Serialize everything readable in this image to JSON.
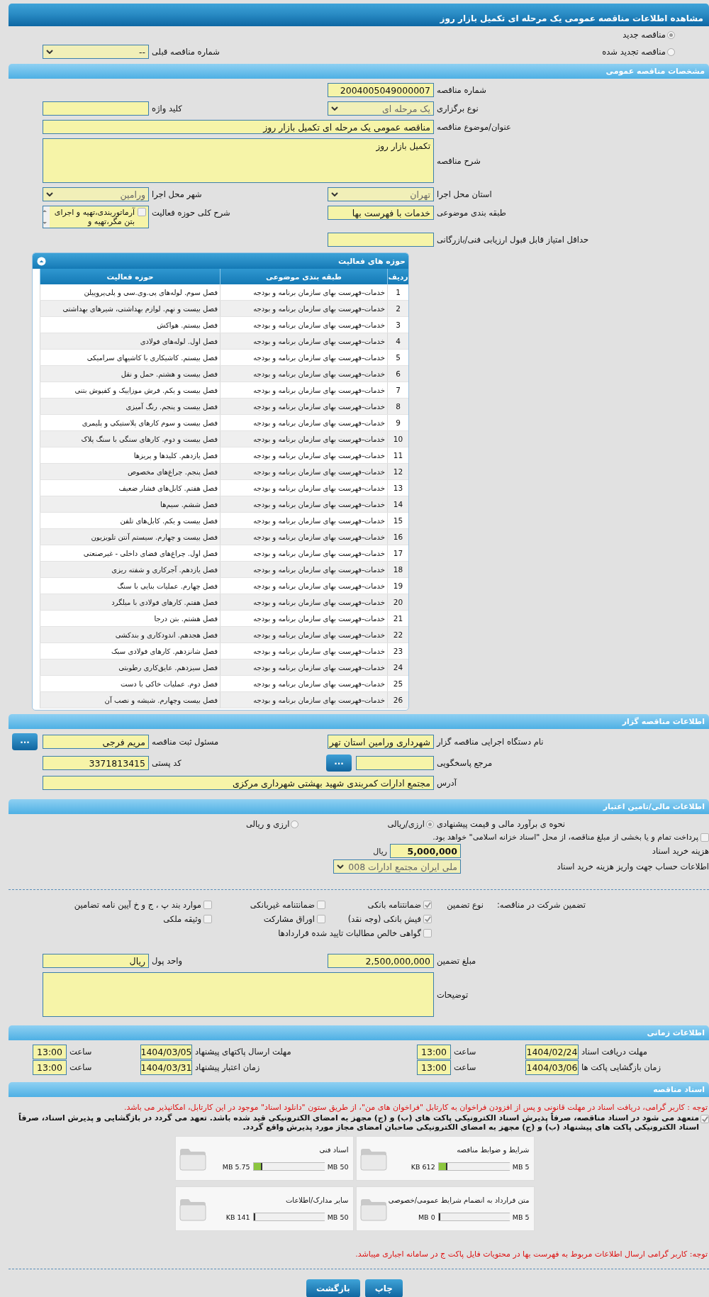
{
  "window": {
    "title": "مشاهده اطلاعات مناقصه عمومی یک مرحله ای تکمیل بازار روز"
  },
  "tender_type": {
    "options": [
      {
        "label": "مناقصه جدید",
        "selected": true
      },
      {
        "label": "مناقصه تجدید شده",
        "selected": false
      }
    ],
    "previous_tender": {
      "kind": "select",
      "label": "شماره مناقصه قبلی",
      "value": "--"
    }
  },
  "general": {
    "title": "مشخصات مناقصه عمومی",
    "rows": [
      [
        {
          "kind": "text",
          "label": "شماره مناقصه",
          "value": "2004005049000007"
        }
      ],
      [
        {
          "kind": "select",
          "label": "نوع برگزاری",
          "value": "یک مرحله ای"
        },
        {
          "kind": "text",
          "label": "کلید واژه"
        }
      ],
      [
        {
          "kind": "wide_text",
          "label": "عنوان/موضوع مناقصه",
          "value": "مناقصه عمومی یک مرحله ای تکمیل بازار روز"
        }
      ],
      [
        {
          "kind": "textarea",
          "label": "شرح مناقصه",
          "value": "تکمیل بازار روز"
        }
      ],
      [
        {
          "kind": "select",
          "label": "استان محل اجرا",
          "value": "تهران"
        },
        {
          "kind": "select",
          "label": "شهر محل اجرا",
          "value": "ورامین"
        }
      ],
      [
        {
          "kind": "text",
          "label": "طبقه بندی موضوعی",
          "value": "خدمات با فهرست بها"
        },
        {
          "kind": "checklist",
          "label": "شرح کلی حوزه فعالیت",
          "items": [
            {
              "label": "آرماتوربندی،تهیه و اجرای بتن مگر،تهیه و",
              "checked": false
            }
          ]
        }
      ],
      [
        {
          "kind": "text",
          "label": "حداقل امتیاز قابل قبول ارزیابی فنی/بازرگانی"
        }
      ]
    ]
  },
  "activities": {
    "title": "حوزه های فعالیت",
    "expanded": true,
    "columns": [
      "ردیف",
      "طبقه بندی موضوعی",
      "حوزه فعالیت"
    ],
    "rows": [
      [
        "1",
        "خدمات-فهرست بهای سازمان برنامه و بودجه",
        "فصل سوم. لوله‌های پی.وی.سی و پلی‌پروپیلن"
      ],
      [
        "2",
        "خدمات-فهرست بهای سازمان برنامه و بودجه",
        "فصل بیست و نهم. لوازم بهداشتی، شیرهای بهداشتی"
      ],
      [
        "3",
        "خدمات-فهرست بهای سازمان برنامه و بودجه",
        "فصل بیستم. هواکش"
      ],
      [
        "4",
        "خدمات-فهرست بهای سازمان برنامه و بودجه",
        "فصل اول. لوله‌های فولادی"
      ],
      [
        "5",
        "خدمات-فهرست بهای سازمان برنامه و بودجه",
        "فصل بیستم. کاشیکاری با کاشیهای سرامیکی"
      ],
      [
        "6",
        "خدمات-فهرست بهای سازمان برنامه و بودجه",
        "فصل بیست و هشتم. حمل و نقل"
      ],
      [
        "7",
        "خدمات-فهرست بهای سازمان برنامه و بودجه",
        "فصل بیست و یکم. فرش موزاییک و کفپوش بتنی"
      ],
      [
        "8",
        "خدمات-فهرست بهای سازمان برنامه و بودجه",
        "فصل بیست و پنجم. رنگ آمیزی"
      ],
      [
        "9",
        "خدمات-فهرست بهای سازمان برنامه و بودجه",
        "فصل بیست و سوم کارهای پلاستیکی و پلیمری"
      ],
      [
        "10",
        "خدمات-فهرست بهای سازمان برنامه و بودجه",
        "فصل بیست و دوم. کارهای سنگی با سنگ پلاک"
      ],
      [
        "11",
        "خدمات-فهرست بهای سازمان برنامه و بودجه",
        "فصل یازدهم. کلیدها و پریزها"
      ],
      [
        "12",
        "خدمات-فهرست بهای سازمان برنامه و بودجه",
        "فصل پنجم. چراغ‌های مخصوص"
      ],
      [
        "13",
        "خدمات-فهرست بهای سازمان برنامه و بودجه",
        "فصل هفتم. کابل‌های فشار ضعیف"
      ],
      [
        "14",
        "خدمات-فهرست بهای سازمان برنامه و بودجه",
        "فصل ششم. سیم‌ها"
      ],
      [
        "15",
        "خدمات-فهرست بهای سازمان برنامه و بودجه",
        "فصل بیست و یکم. کابل‌های تلفن"
      ],
      [
        "16",
        "خدمات-فهرست بهای سازمان برنامه و بودجه",
        "فصل بیست و چهارم. سیستم آنتن تلویزیون"
      ],
      [
        "17",
        "خدمات-فهرست بهای سازمان برنامه و بودجه",
        "فصل اول. چراغ‌های فضای داخلی - غیرصنعتی"
      ],
      [
        "18",
        "خدمات-فهرست بهای سازمان برنامه و بودجه",
        "فصل یازدهم. آجرکاری و شفته ریزی"
      ],
      [
        "19",
        "خدمات-فهرست بهای سازمان برنامه و بودجه",
        "فصل چهارم. عملیات بنایی با سنگ"
      ],
      [
        "20",
        "خدمات-فهرست بهای سازمان برنامه و بودجه",
        "فصل هفتم. کارهای فولادی با میلگرد"
      ],
      [
        "21",
        "خدمات-فهرست بهای سازمان برنامه و بودجه",
        "فصل هشتم. بتن درجا"
      ],
      [
        "22",
        "خدمات-فهرست بهای سازمان برنامه و بودجه",
        "فصل هجدهم. اندودکاری و بندکشی"
      ],
      [
        "23",
        "خدمات-فهرست بهای سازمان برنامه و بودجه",
        "فصل شانزدهم. کارهای فولادی سبک"
      ],
      [
        "24",
        "خدمات-فهرست بهای سازمان برنامه و بودجه",
        "فصل سیزدهم. عایق‌کاری رطوبتی"
      ],
      [
        "25",
        "خدمات-فهرست بهای سازمان برنامه و بودجه",
        "فصل دوم. عملیات خاکی با دست"
      ],
      [
        "26",
        "خدمات-فهرست بهای سازمان برنامه و بودجه",
        "فصل بیست وچهارم. شیشه و نصب آن"
      ]
    ]
  },
  "organizer": {
    "title": "اطلاعات مناقصه گزار",
    "rows": [
      [
        {
          "kind": "text",
          "label": "نام دستگاه اجرایی مناقصه گزار",
          "value": "شهرداری ورامین استان تهر"
        },
        {
          "kind": "text_button",
          "label": "مسئول ثبت مناقصه",
          "value": "مریم فرجی",
          "button": "..."
        }
      ],
      [
        {
          "kind": "text_button",
          "label": "مرجع پاسخگویی",
          "button": "..."
        },
        {
          "kind": "text",
          "label": "کد پستی",
          "value": "3371813415"
        }
      ],
      [
        {
          "kind": "wide_text",
          "label": "آدرس",
          "value": "مجتمع ادارات کمربندی شهید بهشتی شهرداری مرکزی"
        }
      ]
    ]
  },
  "financial": {
    "title": "اطلاعات مالی/تامین اعتبار",
    "estimate": {
      "label": "نحوه ی برآورد مالی و قیمت پیشنهادی",
      "options": [
        {
          "label": "ارزی/ریالی",
          "selected": true
        },
        {
          "label": "ارزی و ریالی",
          "selected": false
        }
      ]
    },
    "treasury": {
      "label": "پرداخت تمام و یا بخشی از مبلغ مناقصه، از محل \"اسناد خزانه اسلامی\" خواهد بود.",
      "checked": false
    },
    "document_fee": {
      "label": "هزینه خرید اسناد",
      "value": "5,000,000",
      "unit": "ریال"
    },
    "account": {
      "label": "اطلاعات حساب جهت واریز هزینه خرید اسناد",
      "value": "ملی ایران مجتمع ادارات 008"
    }
  },
  "guarantee": {
    "label": "تضمین شرکت در مناقصه:",
    "type_label": "نوع تضمین",
    "options": [
      {
        "label": "ضمانتنامه بانکی",
        "checked": true
      },
      {
        "label": "ضمانتنامه غیربانکی",
        "checked": false
      },
      {
        "label": "موارد بند پ ، ج و خ آیین نامه تضامین",
        "checked": false
      },
      {
        "label": "فیش بانکی (وجه نقد)",
        "checked": true
      },
      {
        "label": "اوراق مشارکت",
        "checked": false
      },
      {
        "label": "وثیقه ملکی",
        "checked": false
      },
      {
        "label": "گواهی خالص مطالبات تایید شده قراردادها",
        "checked": false
      }
    ],
    "rows": [
      [
        {
          "kind": "text",
          "label": "مبلغ تضمین",
          "value": "2,500,000,000"
        },
        {
          "kind": "text",
          "label": "واحد پول",
          "value": "ریال"
        }
      ],
      [
        {
          "kind": "textarea",
          "label": "توضیحات"
        }
      ]
    ]
  },
  "schedule": {
    "title": "اطلاعات زمانی",
    "rows": [
      [
        {
          "label": "مهلت دریافت اسناد",
          "date": "1404/02/24",
          "time_label": "ساعت",
          "time": "13:00"
        },
        {
          "label": "مهلت ارسال پاکتهای پیشنهاد",
          "date": "1404/03/05",
          "time_label": "ساعت",
          "time": "13:00"
        }
      ],
      [
        {
          "label": "زمان بازگشایی پاکت ها",
          "date": "1404/03/06",
          "time_label": "ساعت",
          "time": "13:00"
        },
        {
          "label": "زمان اعتبار پیشنهاد",
          "date": "1404/03/31",
          "time_label": "ساعت",
          "time": "13:00"
        }
      ]
    ]
  },
  "documents": {
    "title": "اسناد مناقصه",
    "notice": "توجه : کاربر گرامی، دریافت اسناد در مهلت قانونی و پس از افزودن فراخوان به کارتابل \"فراخوان های من\"، از طریق ستون \"دانلود اسناد\" موجود در این کارتابل، امکانپذیر می باشد.",
    "commitment": {
      "text": "متعهد می شود در اسناد مناقصه، صرفاً پذیرش اسناد الکترونیکی پاکت های (ب) و (ج) مجهز به امضای الکترونیکی قید شده باشد. تعهد می گردد در بازگشایی و پذیرش اسناد، صرفاً اسناد الکترونیکی پاکت های پیشنهاد (ب) و (ج) مجهز به امضای الکترونیکی صاحبان امضای مجاز مورد پذیرش واقع گردد.",
      "checked": true
    },
    "files": [
      {
        "title": "شرایط و ضوابط مناقصه",
        "max": "5 MB",
        "size": "612 KB",
        "level": 0.12
      },
      {
        "title": "اسناد فنی",
        "max": "50 MB",
        "size": "5.75 MB",
        "level": 0.12
      },
      {
        "title": "متن قرارداد به انضمام شرایط عمومی/خصوصی",
        "max": "5 MB",
        "size": "0 MB",
        "level": 0
      },
      {
        "title": "سایر مدارک/اطلاعات",
        "max": "50 MB",
        "size": "141 KB",
        "level": 0.01
      }
    ],
    "footer_notice": "توجه: کاربر گرامی ارسال اطلاعات مربوط به فهرست بها در محتویات فایل پاکت ج در سامانه اجباری میباشد."
  },
  "buttons": [
    "چاپ",
    "بازگشت"
  ]
}
